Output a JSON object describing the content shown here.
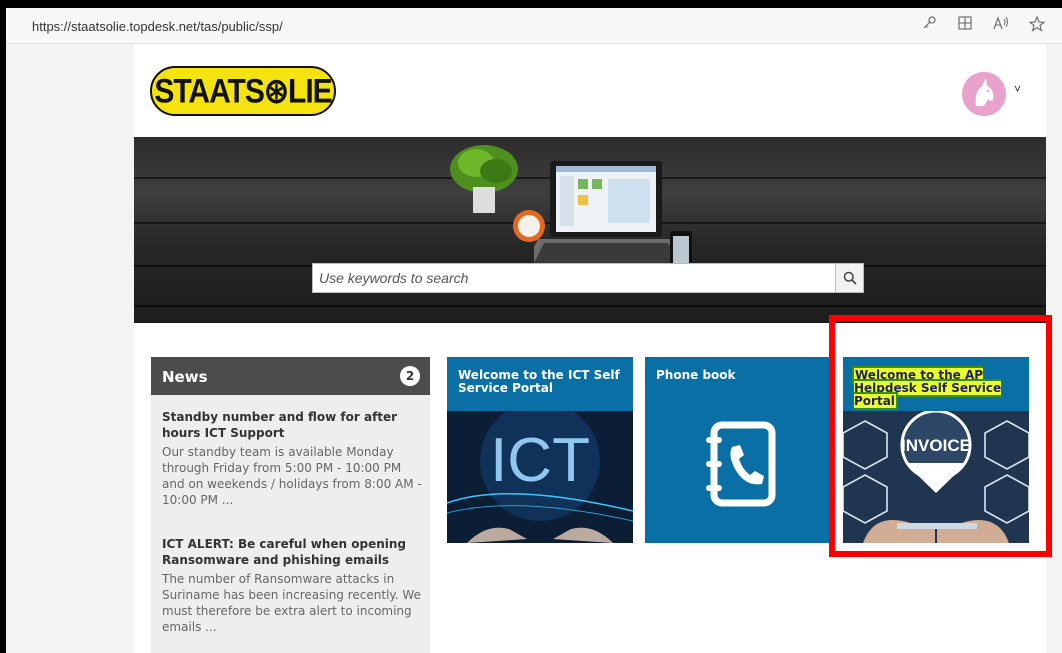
{
  "browser": {
    "url": "https://staatsolie.topdesk.net/tas/public/ssp/",
    "icons": [
      "key-icon",
      "grid-add-icon",
      "read-aloud-icon",
      "favorite-star-icon"
    ]
  },
  "header": {
    "logo_text": "STAATS⊛LIE",
    "account_chevron": "˅"
  },
  "search": {
    "placeholder": "Use keywords to search"
  },
  "news": {
    "title": "News",
    "count": "2",
    "items": [
      {
        "title": "Standby number and flow for after hours ICT Support",
        "body": "Our standby team is available Monday through Friday from 5:00 PM - 10:00 PM and on weekends / holidays from 8:00 AM - 10:00 PM ..."
      },
      {
        "title": "ICT ALERT: Be careful when opening Ransomware and phishing emails",
        "body": "The number of Ransomware attacks in Suriname has been increasing recently. We must therefore be extra alert to incoming emails ..."
      }
    ]
  },
  "tiles": [
    {
      "title": "Welcome to the ICT Self Service Portal",
      "image_text": "ICT"
    },
    {
      "title": "Phone book"
    },
    {
      "title": "Welcome to the AP Helpdesk Self Service Portal",
      "image_text": "INVOICE"
    }
  ],
  "colors": {
    "tile_blue": "#0a6fa5",
    "news_header": "#4c4c4c",
    "logo_yellow": "#f5e30f",
    "highlight": "#e9ff2e",
    "annotation_red": "#ff0000"
  }
}
